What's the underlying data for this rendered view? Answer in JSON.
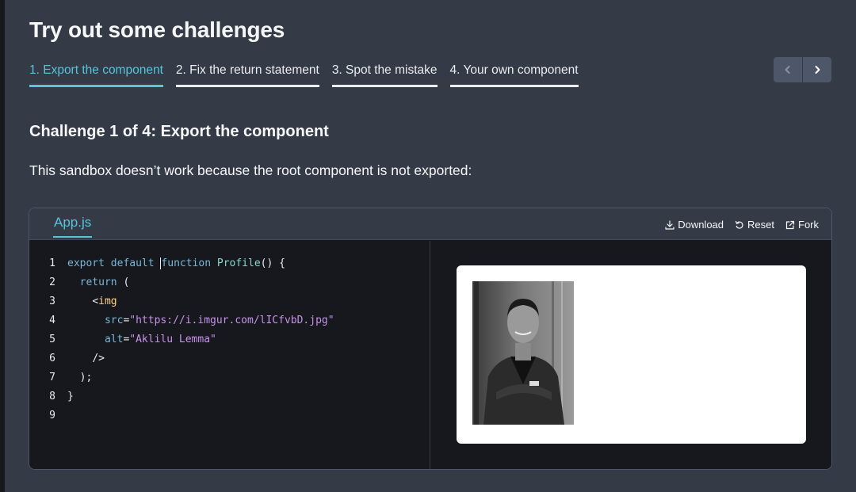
{
  "page": {
    "title": "Try out some challenges"
  },
  "tabs": [
    {
      "label": "1. Export the component",
      "active": true
    },
    {
      "label": "2. Fix the return statement",
      "active": false
    },
    {
      "label": "3. Spot the mistake",
      "active": false
    },
    {
      "label": "4. Your own component",
      "active": false
    }
  ],
  "nav": {
    "prev_icon": "chevron-left-icon",
    "next_icon": "chevron-right-icon"
  },
  "challenge": {
    "counter": "Challenge 1 of 4:",
    "name": "Export the component",
    "description": "This sandbox doesn’t work because the root component is not exported:"
  },
  "sandbox": {
    "file_tab": "App.js",
    "actions": {
      "download": "Download",
      "reset": "Reset",
      "fork": "Fork"
    },
    "line_numbers": [
      "1",
      "2",
      "3",
      "4",
      "5",
      "6",
      "7",
      "8",
      "9"
    ],
    "code": {
      "l1_kw1": "export",
      "l1_kw2": "default",
      "l1_kw3": "function",
      "l1_fn": "Profile",
      "l1_rest": "() {",
      "l2_kw": "return",
      "l2_rest": "(",
      "l3_punct": "<",
      "l3_tag": "img",
      "l4_attr": "src",
      "l4_eq": "=",
      "l4_str": "\"https://i.imgur.com/lICfvbD.jpg\"",
      "l5_attr": "alt",
      "l5_eq": "=",
      "l5_str": "\"Aklilu Lemma\"",
      "l6": "/>",
      "l7": ");",
      "l8": "}"
    }
  },
  "colors": {
    "accent": "#58c4dc",
    "background": "#343a46",
    "editor_bg": "#16181d"
  }
}
